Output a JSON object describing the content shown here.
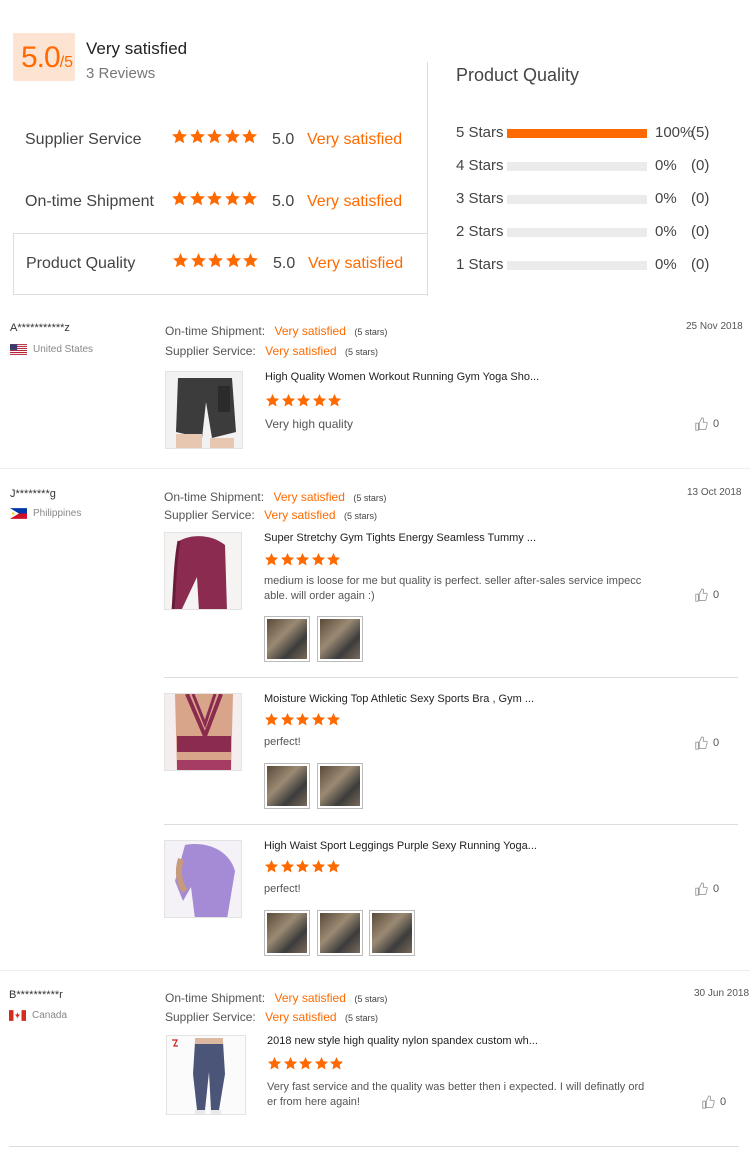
{
  "summary": {
    "score": "5.0",
    "score_max": "/5",
    "label": "Very satisfied",
    "reviews_count": "3 Reviews"
  },
  "ratings": [
    {
      "label": "Supplier Service",
      "score": "5.0",
      "text": "Very satisfied"
    },
    {
      "label": "On-time Shipment",
      "score": "5.0",
      "text": "Very satisfied"
    },
    {
      "label": "Product Quality",
      "score": "5.0",
      "text": "Very satisfied"
    }
  ],
  "product_quality": {
    "title": "Product Quality",
    "rows": [
      {
        "label": "5 Stars",
        "pct": "100%",
        "count": "(5)",
        "fraction": 1.0
      },
      {
        "label": "4 Stars",
        "pct": "0%",
        "count": "(0)",
        "fraction": 0
      },
      {
        "label": "3 Stars",
        "pct": "0%",
        "count": "(0)",
        "fraction": 0
      },
      {
        "label": "2 Stars",
        "pct": "0%",
        "count": "(0)",
        "fraction": 0
      },
      {
        "label": "1 Stars",
        "pct": "0%",
        "count": "(0)",
        "fraction": 0
      }
    ]
  },
  "meta_labels": {
    "shipment": "On-time Shipment:",
    "service": "Supplier Service:"
  },
  "reviews": [
    {
      "reviewer": "A***********z",
      "country": "United States",
      "date": "25 Nov 2018",
      "shipment": "Very satisfied",
      "shipment_stars": "(5 stars)",
      "service": "Very satisfied",
      "service_stars": "(5 stars)",
      "items": [
        {
          "title": "High Quality Women Workout Running Gym Yoga Sho...",
          "comment": "Very high quality",
          "likes": "0"
        }
      ]
    },
    {
      "reviewer": "J********g",
      "country": "Philippines",
      "date": "13 Oct 2018",
      "shipment": "Very satisfied",
      "shipment_stars": "(5 stars)",
      "service": "Very satisfied",
      "service_stars": "(5 stars)",
      "items": [
        {
          "title": "Super Stretchy Gym Tights Energy Seamless Tummy ...",
          "comment_1": "medium is loose for me but quality is perfect. seller after-sales service impecc",
          "comment_2": "able. will order again :)",
          "likes": "0"
        },
        {
          "title": "Moisture Wicking Top Athletic Sexy Sports Bra , Gym ...",
          "comment": "perfect!",
          "likes": "0"
        },
        {
          "title": "High Waist Sport Leggings Purple Sexy Running Yoga...",
          "comment": "perfect!",
          "likes": "0"
        }
      ]
    },
    {
      "reviewer": "B**********r",
      "country": "Canada",
      "date": "30 Jun 2018",
      "shipment": "Very satisfied",
      "shipment_stars": "(5 stars)",
      "service": "Very satisfied",
      "service_stars": "(5 stars)",
      "items": [
        {
          "title": "2018 new style high quality nylon spandex custom wh...",
          "comment_1": "Very fast service and the quality was better then i expected. I will definatly ord",
          "comment_2": "er from here again!",
          "likes": "0"
        }
      ]
    }
  ],
  "colors": {
    "accent": "#ff6a00",
    "score_bg": "#fde3d2"
  }
}
